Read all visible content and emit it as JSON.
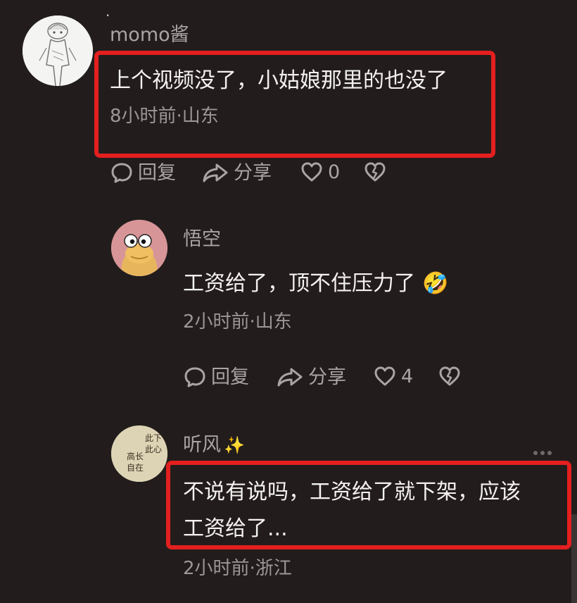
{
  "comments": [
    {
      "username": "momo酱",
      "text": "上个视频没了，小姑娘那里的也没了",
      "meta": "8小时前·山东",
      "reply_label": "回复",
      "share_label": "分享",
      "like_count": "0"
    },
    {
      "username": "悟空",
      "text": "工资给了，顶不住压力了",
      "emoji": "🤣",
      "meta": "2小时前·山东",
      "reply_label": "回复",
      "share_label": "分享",
      "like_count": "4"
    },
    {
      "username": "听风",
      "username_emoji": "✨",
      "text_line1": "不说有说吗，工资给了就下架，应该",
      "text_line2": "工资给了...",
      "meta": "2小时前·浙江"
    }
  ],
  "avatar3_calligraphy": "此下此心 高长自在",
  "colors": {
    "background": "#221d1c",
    "highlight": "#e41f1f",
    "muted_text": "#a9a5a4"
  }
}
